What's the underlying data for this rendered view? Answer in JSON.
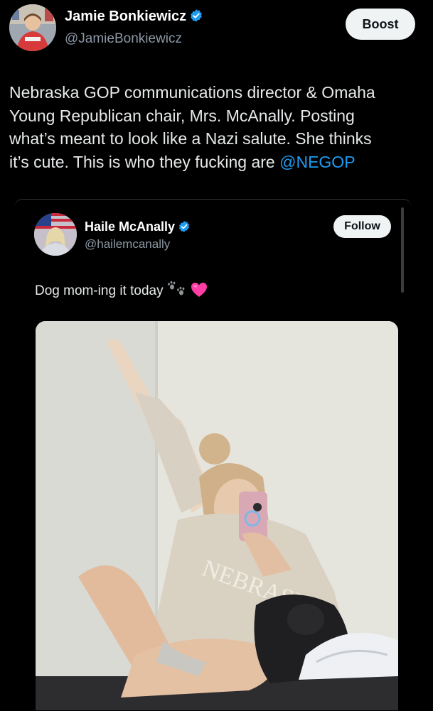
{
  "post": {
    "author_name": "Jamie Bonkiewicz",
    "author_handle": "@JamieBonkiewicz",
    "boost_label": "Boost",
    "text_lines": [
      "Nebraska GOP communications director & Omaha",
      "Young Republican chair, Mrs. McAnally. Posting",
      "what’s meant to look like a Nazi salute. She thinks",
      "it’s cute. This is who they fucking are "
    ],
    "mention": "@NEGOP"
  },
  "quoted_post": {
    "author_name": "Haile McAnally",
    "author_handle": "@hailemcanally",
    "follow_label": "Follow",
    "text": "Dog mom-ing it today",
    "media_icon": "photo"
  },
  "icons": {
    "verified": "verified-badge-icon",
    "paw": "paw-prints-icon",
    "heart": "pink-heart-icon"
  },
  "colors": {
    "background": "#000000",
    "text": "#e7e9ea",
    "secondary_text": "#8b98a5",
    "link": "#1d9bf0",
    "verified": "#1d9bf0",
    "button_bg": "#eff3f4",
    "heart": "#ff3ea5"
  }
}
